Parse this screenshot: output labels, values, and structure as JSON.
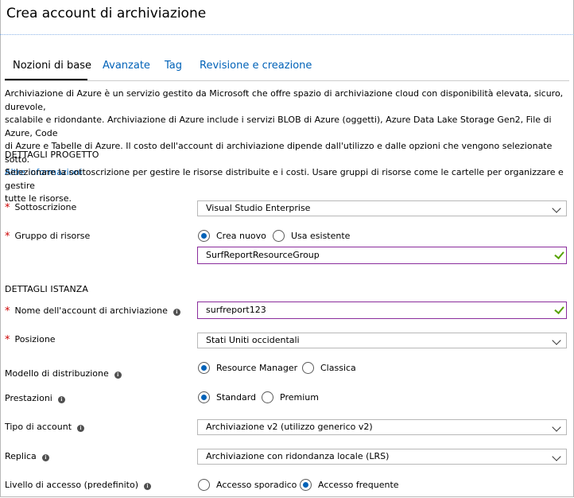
{
  "page": {
    "title": "Crea account di archiviazione"
  },
  "tabs": [
    {
      "label": "Nozioni di base",
      "active": true
    },
    {
      "label": "Avanzate"
    },
    {
      "label": "Tag"
    },
    {
      "label": "Revisione e creazione"
    }
  ],
  "intro": {
    "line1": "Archiviazione di Azure è un servizio gestito da Microsoft che offre spazio di archiviazione cloud con disponibilità elevata, sicuro, durevole,",
    "line2": "scalabile e ridondante. Archiviazione di Azure include i servizi BLOB di Azure (oggetti), Azure Data Lake Storage Gen2, File di Azure, Code",
    "line3": "di Azure e Tabelle di Azure. Il costo dell'account di archiviazione dipende dall'utilizzo e dalle opzioni che vengono selezionate sotto.",
    "link": "Altre informazioni"
  },
  "project": {
    "heading": "DETTAGLI PROGETTO",
    "desc_line1": "Selezionare la sottoscrizione per gestire le risorse distribuite e i costi. Usare gruppi di risorse come le cartelle per organizzare e gestire",
    "desc_line2": "tutte le risorse.",
    "subscription": {
      "label": "Sottoscrizione",
      "value": "Visual Studio Enterprise"
    },
    "resource_group": {
      "label": "Gruppo di risorse",
      "options": [
        "Crea nuovo",
        "Usa esistente"
      ],
      "selected": "Crea nuovo",
      "value": "SurfReportResourceGroup"
    }
  },
  "instance": {
    "heading": "DETTAGLI ISTANZA",
    "account_name": {
      "label": "Nome dell'account di archiviazione",
      "value": "surfreport123"
    },
    "location": {
      "label": "Posizione",
      "value": "Stati Uniti occidentali"
    },
    "deployment_model": {
      "label": "Modello di distribuzione",
      "options": [
        "Resource Manager",
        "Classica"
      ],
      "selected": "Resource Manager"
    },
    "performance": {
      "label": "Prestazioni",
      "options": [
        "Standard",
        "Premium"
      ],
      "selected": "Standard"
    },
    "account_kind": {
      "label": "Tipo di account",
      "value": "Archiviazione v2 (utilizzo generico v2)"
    },
    "replication": {
      "label": "Replica",
      "value": "Archiviazione con ridondanza locale (LRS)"
    },
    "access_tier": {
      "label": "Livello di accesso (predefinito)",
      "options": [
        "Accesso sporadico",
        "Accesso frequente"
      ],
      "selected": "Accesso frequente"
    }
  },
  "colors": {
    "link": "#0062b8",
    "required": "#cc0000",
    "valid": "#57a300",
    "focus_border": "#8a2d9c"
  },
  "icons": {
    "info": "info-icon",
    "dropdown": "chevron-down-icon",
    "valid": "checkmark-icon"
  }
}
